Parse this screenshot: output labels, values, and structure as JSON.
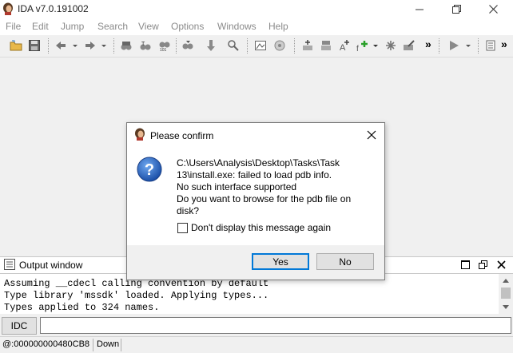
{
  "window": {
    "title": "IDA v7.0.191002"
  },
  "menu": [
    "File",
    "Edit",
    "Jump",
    "Search",
    "View",
    "Options",
    "Windows",
    "Help"
  ],
  "toolbar": {
    "overflow": "»",
    "overflow2": "»"
  },
  "output": {
    "title": "Output window",
    "lines": [
      "Assuming __cdecl calling convention by default",
      "Type library 'mssdk' loaded. Applying types...",
      "Types applied to 324 names."
    ]
  },
  "idc": {
    "label": "IDC",
    "value": ""
  },
  "status": {
    "address": "@:000000000480CB8",
    "direction": "Down"
  },
  "dialog": {
    "title": "Please confirm",
    "message_lines": [
      "C:\\Users\\Analysis\\Desktop\\Tasks\\Task",
      "13\\install.exe: failed to load pdb info.",
      "No such interface supported",
      "Do you want to browse for the pdb file on",
      "disk?"
    ],
    "checkbox_label": "Don't display this message again",
    "yes_label": "Yes",
    "no_label": "No"
  }
}
